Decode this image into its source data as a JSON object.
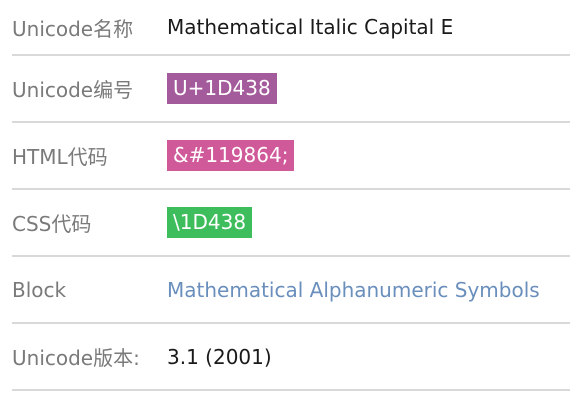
{
  "rows": [
    {
      "label": "Unicode名称",
      "value": "Mathematical Italic Capital E"
    },
    {
      "label": "Unicode编号",
      "value": "U+1D438",
      "color": "#a45b9c"
    },
    {
      "label": "HTML代码",
      "value": "&#119864;",
      "color": "#d0599a"
    },
    {
      "label": "CSS代码",
      "value": "\\1D438",
      "color": "#3dbd5b"
    },
    {
      "label": "Block",
      "value": "Mathematical Alphanumeric Symbols",
      "color": "#6a8fbd"
    },
    {
      "label": "Unicode版本:",
      "value": "3.1 (2001)"
    }
  ]
}
